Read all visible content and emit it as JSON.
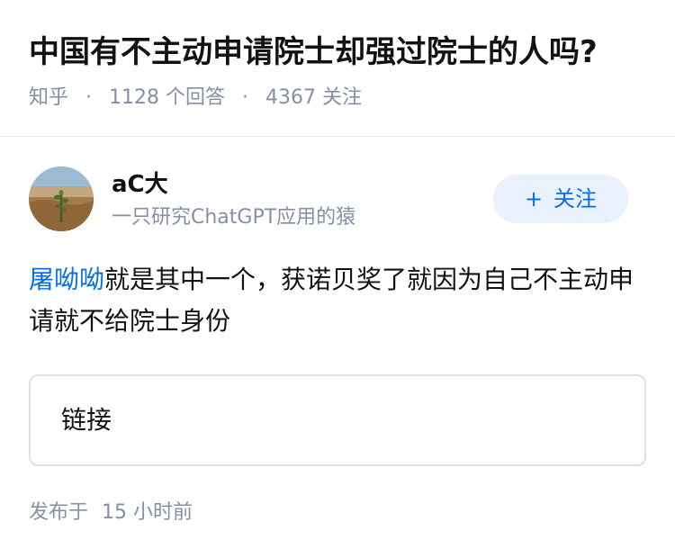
{
  "question": {
    "title": "中国有不主动申请院士却强过院士的人吗?",
    "source": "知乎",
    "answer_count": "1128",
    "answer_suffix": "个回答",
    "follower_count": "4367",
    "follower_suffix": "关注"
  },
  "author": {
    "name": "aC大",
    "bio": "一只研究ChatGPT应用的猿",
    "follow_label": "关注",
    "follow_icon": "plus-icon"
  },
  "answer": {
    "mention": "屠呦呦",
    "text_rest": "就是其中一个，获诺贝奖了就因为自己不主动申请就不给院士身份",
    "link_label": "链接"
  },
  "footer": {
    "published_prefix": "发布于",
    "published_value": "15 小时前"
  },
  "colors": {
    "accent": "#056de8",
    "muted": "#8590a6",
    "follow_bg": "#e8f1fc"
  }
}
